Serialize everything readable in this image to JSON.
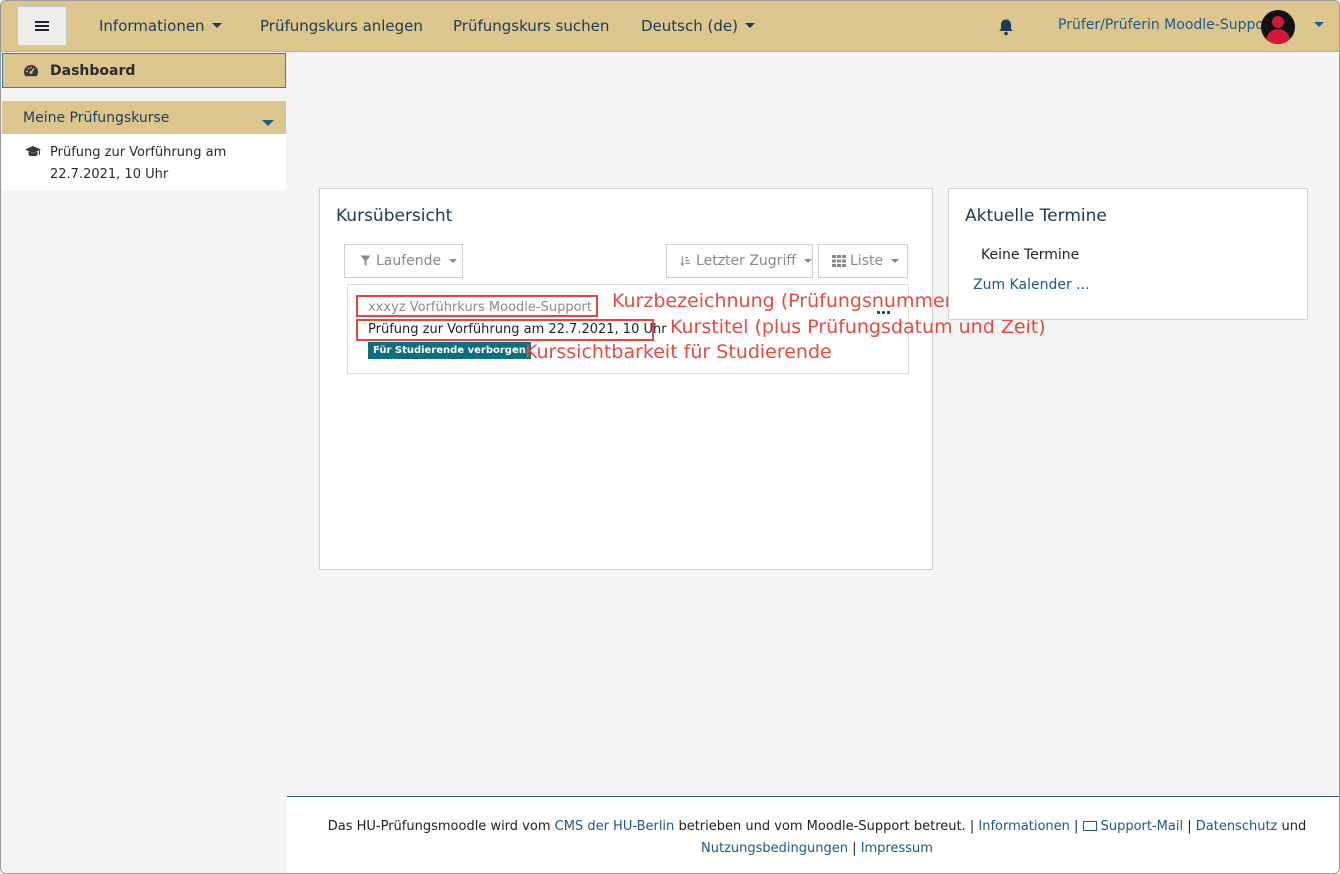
{
  "navbar": {
    "items": [
      "Informationen",
      "Prüfungskurs anlegen",
      "Prüfungskurs suchen",
      "Deutsch (de)"
    ],
    "user_name": "Prüfer/Prüferin Moodle-Support"
  },
  "sidebar": {
    "dashboard": "Dashboard",
    "my_courses": "Meine Prüfungskurse",
    "course_item": "Prüfung zur Vorführung am 22.7.2021, 10 Uhr"
  },
  "overview": {
    "title": "Kursübersicht",
    "filter": "Laufende",
    "sort": "Letzter Zugriff",
    "view": "Liste",
    "course_shortname": "xxxyz Vorführkurs Moodle-Support",
    "course_fullname": "Prüfung zur Vorführung am 22.7.2021, 10 Uhr",
    "visibility_badge": "Für Studierende verborgen"
  },
  "annotations": {
    "shortname": "Kurzbezeichnung (Prüfungsnummer)",
    "fullname": "Kurstitel (plus Prüfungsdatum und Zeit)",
    "visibility": "Kurssichtbarkeit für Studierende"
  },
  "events": {
    "title": "Aktuelle Termine",
    "none": "Keine Termine",
    "calendar_link": "Zum Kalender ..."
  },
  "footer": {
    "t1": "Das HU-Prüfungsmoodle wird vom",
    "cms": "CMS der HU-Berlin",
    "t2": "betrieben und vom Moodle-Support betreut. |",
    "info": "Informationen",
    "sep": "|",
    "mail": "Support-Mail",
    "privacy": "Datenschutz",
    "and": "und",
    "terms": "Nutzungsbedingungen",
    "imprint": "Impressum"
  },
  "colors": {
    "navbar": "#dcc68e",
    "link": "#1d5a8a",
    "badge": "#0f6f80",
    "annotation": "#e54b3f"
  }
}
